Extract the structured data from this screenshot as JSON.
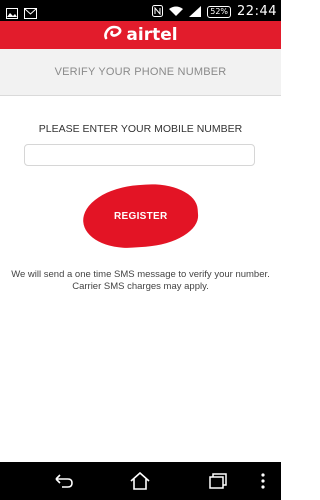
{
  "status_bar": {
    "time": "22:44",
    "battery": "52%"
  },
  "app_bar": {
    "brand": "airtel"
  },
  "header": {
    "title": "VERIFY YOUR PHONE NUMBER"
  },
  "form": {
    "prompt": "PLEASE ENTER YOUR MOBILE NUMBER",
    "phone_value": "",
    "register_label": "REGISTER"
  },
  "info": {
    "line1": "We will send a one time SMS message to verify your number.",
    "line2": "Carrier SMS charges may apply."
  },
  "colors": {
    "brand_red": "#e21c2c",
    "header_bg": "#f2f2f2"
  }
}
